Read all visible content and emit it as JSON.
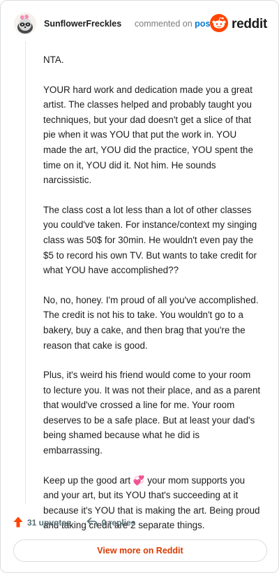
{
  "header": {
    "username": "SunflowerFreckles",
    "commented_on": "commented on",
    "post": "post",
    "brand": "reddit"
  },
  "comment": {
    "paragraphs": [
      "NTA.",
      "YOUR hard work and dedication made you a great artist. The classes helped and probably taught you techniques, but your dad doesn't get a slice of that pie when it was YOU that put the work in. YOU made the art, YOU did the practice, YOU spent the time on it, YOU did it. Not him. He sounds narcissistic.",
      "The class cost a lot less than a lot of other classes you could've taken. For instance/context my singing class was 50$ for 30min. He wouldn't even pay the $5 to record his own TV. But wants to take credit for what YOU have accomplished??",
      "No, no, honey. I'm proud of all you've accomplished. The credit is not his to take. You wouldn't go to a bakery, buy a cake, and then brag that you're the reason that cake is good.",
      "Plus, it's weird his friend would come to your room to lecture you. It was not their place, and as a parent that would've crossed a line for me. Your room deserves to be a safe place. But at least your dad's being shamed because what he did is embarrassing.",
      "Keep up the good art 💞 your mom supports you and your art, but its YOU that's succeeding at it because it's YOU that is making the art. Being proud and taking credit are 2 separate things."
    ]
  },
  "actions": {
    "upvotes": "31 upvotes",
    "replies": "0 replies"
  },
  "cta": {
    "label": "View more on Reddit"
  },
  "colors": {
    "brand_orange": "#ff4500",
    "cta_text": "#d93a00",
    "link_blue": "#0079d3",
    "action_gray": "#576f76"
  },
  "icons": {
    "avatar": "raccoon-avatar-icon",
    "logo": "reddit-snoo-icon",
    "upvote": "upvote-arrow-icon",
    "reply": "reply-arrow-icon"
  }
}
